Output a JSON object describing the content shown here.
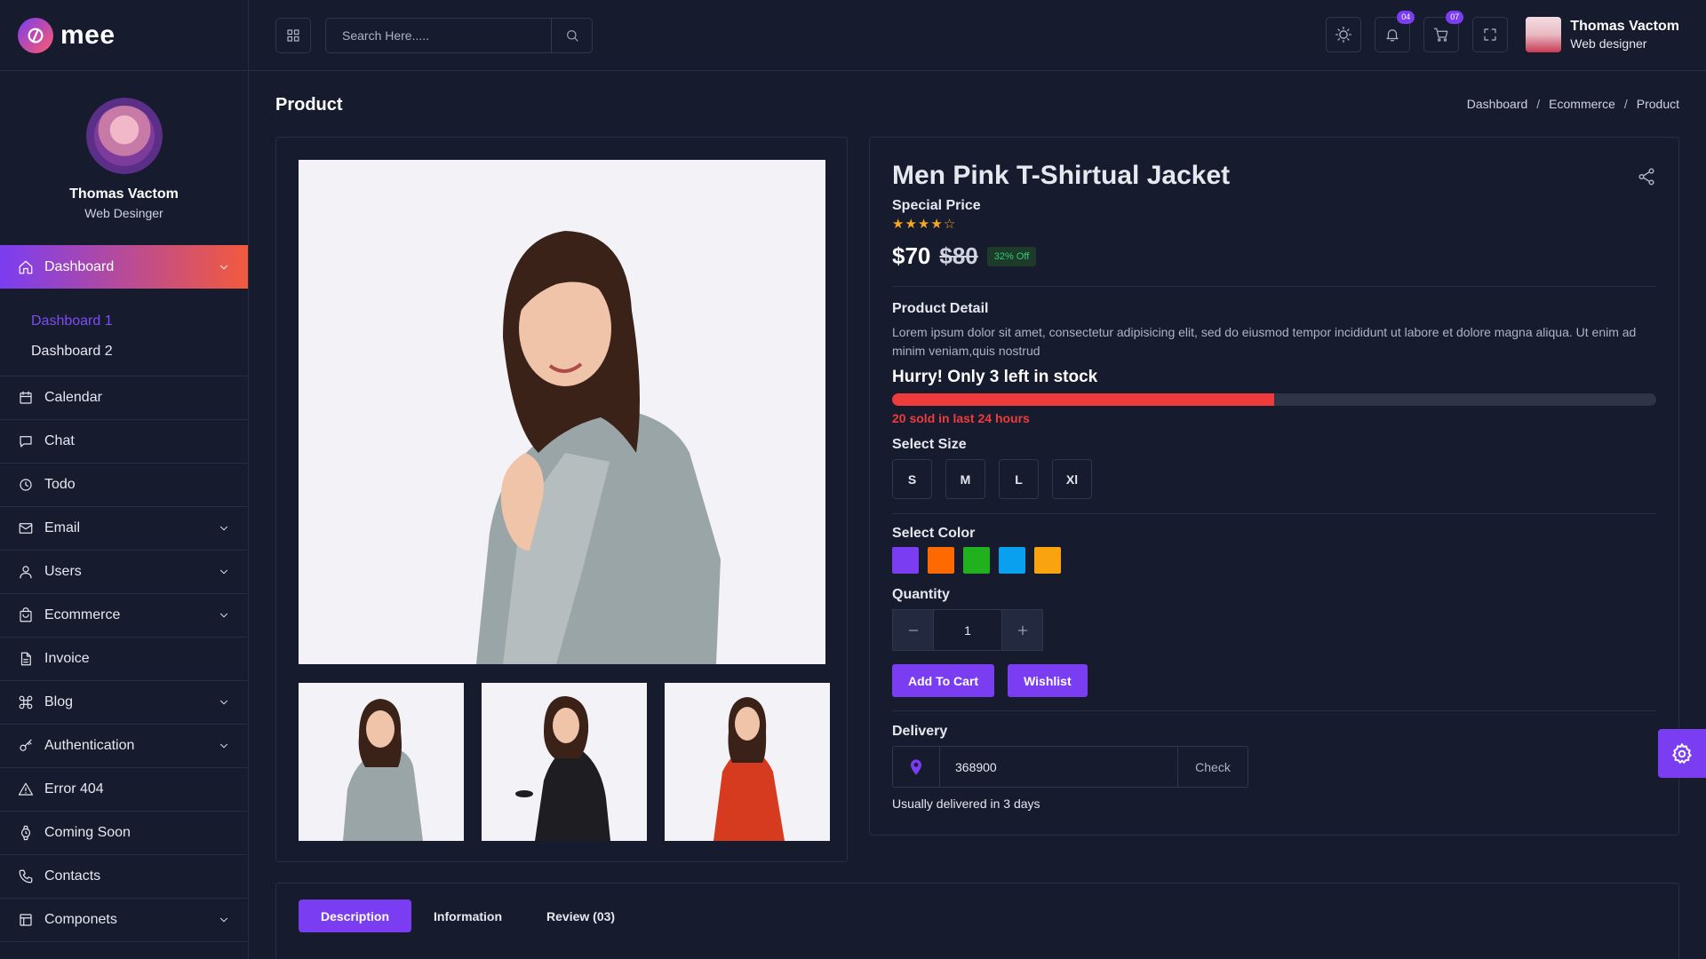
{
  "brand": {
    "name": "mee",
    "accent": "#7b3df2",
    "gradient_end": "#f35a3d"
  },
  "sidebar": {
    "profile": {
      "name": "Thomas Vactom",
      "role": "Web Desinger"
    },
    "active_item": {
      "label": "Dashboard",
      "icon": "home-icon"
    },
    "submenu": [
      "Dashboard 1",
      "Dashboard 2"
    ],
    "items": [
      {
        "label": "Calendar",
        "icon": "calendar-icon",
        "has_children": false
      },
      {
        "label": "Chat",
        "icon": "chat-icon",
        "has_children": false
      },
      {
        "label": "Todo",
        "icon": "clock-icon",
        "has_children": false
      },
      {
        "label": "Email",
        "icon": "mail-icon",
        "has_children": true
      },
      {
        "label": "Users",
        "icon": "user-icon",
        "has_children": true
      },
      {
        "label": "Ecommerce",
        "icon": "bag-icon",
        "has_children": true
      },
      {
        "label": "Invoice",
        "icon": "file-icon",
        "has_children": false
      },
      {
        "label": "Blog",
        "icon": "command-icon",
        "has_children": true
      },
      {
        "label": "Authentication",
        "icon": "key-icon",
        "has_children": true
      },
      {
        "label": "Error 404",
        "icon": "warning-icon",
        "has_children": false
      },
      {
        "label": "Coming Soon",
        "icon": "watch-icon",
        "has_children": false
      },
      {
        "label": "Contacts",
        "icon": "phone-icon",
        "has_children": false
      },
      {
        "label": "Componets",
        "icon": "layout-icon",
        "has_children": true
      }
    ]
  },
  "topbar": {
    "search": {
      "placeholder": "Search Here....."
    },
    "notifications_count": "04",
    "cart_count": "07",
    "user": {
      "name": "Thomas Vactom",
      "role": "Web designer"
    }
  },
  "page": {
    "title": "Product",
    "breadcrumb": [
      "Dashboard",
      "Ecommerce",
      "Product"
    ]
  },
  "product": {
    "title": "Men Pink T-Shirtual Jacket",
    "special_label": "Special Price",
    "rating": 4,
    "rating_max": 5,
    "price": "$70",
    "old_price": "$80",
    "discount": "32% Off",
    "detail_label": "Product Detail",
    "description": "Lorem ipsum dolor sit amet, consectetur adipisicing elit, sed do eiusmod tempor incididunt ut labore et dolore magna aliqua. Ut enim ad minim veniam,quis nostrud",
    "stock_message": "Hurry! Only 3 left in stock",
    "stock_progress": 0.5,
    "sold_message": "20 sold in last 24 hours",
    "size_label": "Select Size",
    "sizes": [
      "S",
      "M",
      "L",
      "Xl"
    ],
    "color_label": "Select Color",
    "colors": [
      "#7b3df2",
      "#ff6a00",
      "#21b11f",
      "#0aa0f0",
      "#f8a30f"
    ],
    "quantity_label": "Quantity",
    "quantity": "1",
    "add_to_cart": "Add To Cart",
    "wishlist": "Wishlist",
    "delivery_label": "Delivery",
    "pincode": "368900",
    "check_label": "Check",
    "delivery_note": "Usually delivered in 3 days"
  },
  "tabs": [
    "Description",
    "Information",
    "Review (03)"
  ]
}
